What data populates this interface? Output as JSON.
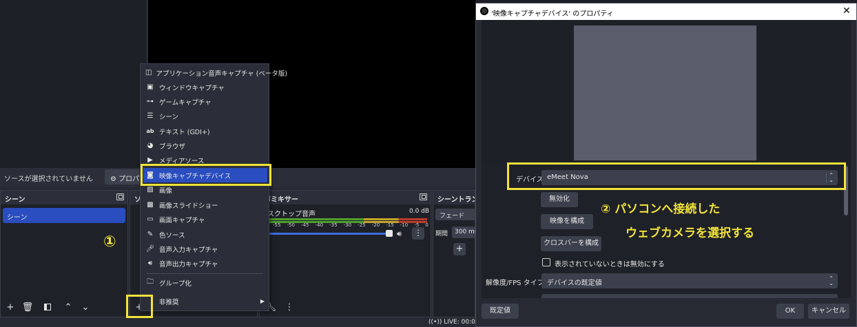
{
  "obs": {
    "no_source_selected": "ソースが選択されていません",
    "properties_button": "プロパティ",
    "docks": {
      "scenes_title": "シーン",
      "sources_title": "ソ",
      "mixer_title": "声ミキサー",
      "transitions_title": "シーントランジ"
    },
    "scenes": [
      "シーン"
    ],
    "mixer": {
      "track_name": "スクトップ音声",
      "db_value": "0.0 dB",
      "scale": [
        "-55",
        "-50",
        "-45",
        "-40",
        "-35",
        "-30",
        "-25",
        "-20",
        "-15",
        "-10",
        "-5",
        "0"
      ]
    },
    "transitions": {
      "type": "フェード",
      "duration_label": "期間",
      "duration_value": "300 ms"
    },
    "status": {
      "live": "LIVE: 00:00:0"
    }
  },
  "menu": {
    "items": [
      {
        "icon": "application-audio-capture-icon",
        "label": "アプリケーション音声キャプチャ (ベータ版)"
      },
      {
        "icon": "window-capture-icon",
        "label": "ウィンドウキャプチャ"
      },
      {
        "icon": "game-controller-icon",
        "label": "ゲームキャプチャ"
      },
      {
        "icon": "scene-list-icon",
        "label": "シーン"
      },
      {
        "icon": "text-icon",
        "label": "テキスト (GDI+)"
      },
      {
        "icon": "globe-icon",
        "label": "ブラウザ"
      },
      {
        "icon": "play-icon",
        "label": "メディアソース"
      },
      {
        "icon": "camera-icon",
        "label": "映像キャプチャデバイス"
      },
      {
        "icon": "image-icon",
        "label": "画像"
      },
      {
        "icon": "slideshow-icon",
        "label": "画像スライドショー"
      },
      {
        "icon": "monitor-icon",
        "label": "画面キャプチャ"
      },
      {
        "icon": "color-brush-icon",
        "label": "色ソース"
      },
      {
        "icon": "microphone-icon",
        "label": "音声入力キャプチャ"
      },
      {
        "icon": "speaker-icon",
        "label": "音声出力キャプチャ"
      },
      {
        "icon": "folder-icon",
        "label": "グループ化"
      },
      {
        "icon": "",
        "label": "非推奨"
      }
    ]
  },
  "dialog": {
    "title": "'映像キャプチャデバイス' のプロパティ",
    "device_label": "デバイス",
    "device_value": "eMeet Nova",
    "deactivate": "無効化",
    "configure_video": "映像を構成",
    "configure_crossbar": "クロスバーを構成",
    "hide_checkbox_label": "表示されていないときは無効にする",
    "resolution_label": "解像度/FPS タイプ",
    "resolution_value": "デバイスの既定値",
    "defaults": "既定値",
    "ok": "OK",
    "cancel": "キャンセル"
  },
  "annotations": {
    "step1": "①",
    "step2_line1": "② パソコンへ接続した",
    "step2_line2": "ウェブカメラを選択する",
    "highlight_color": "#f2e33a"
  }
}
